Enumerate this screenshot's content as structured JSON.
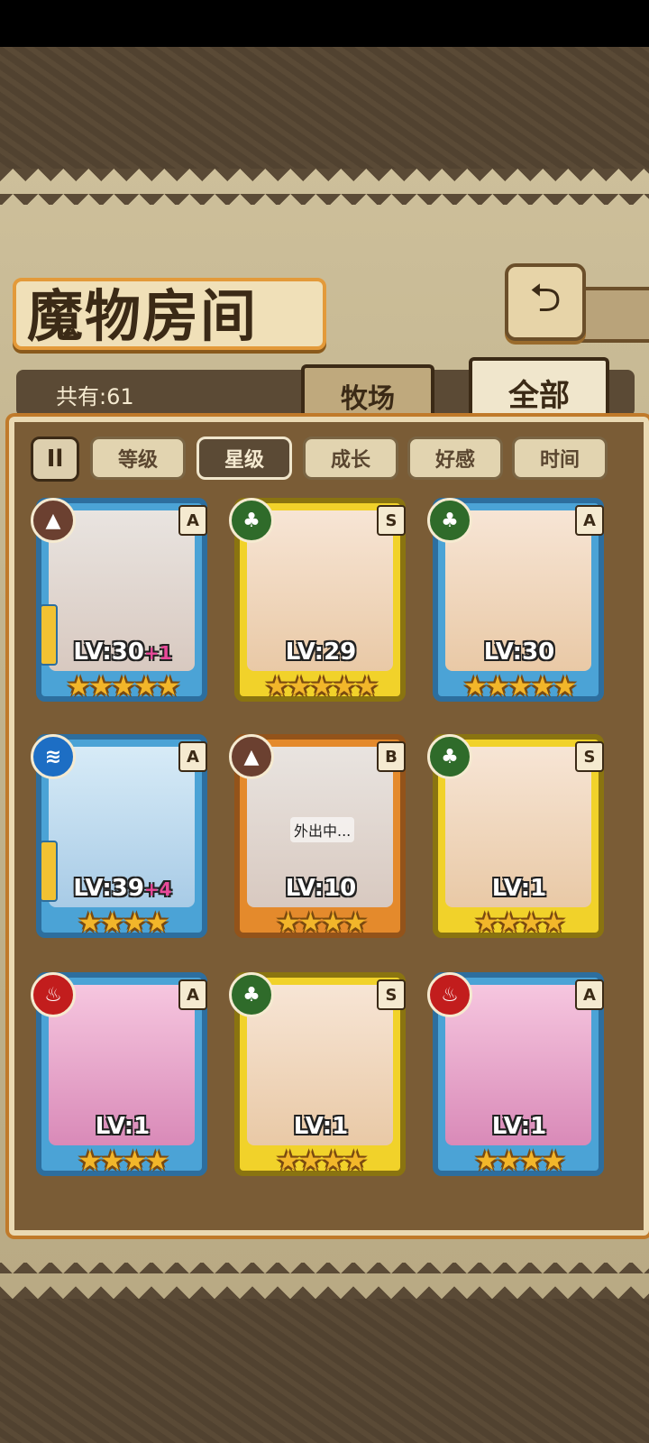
{
  "screen": {
    "title": "魔物房间",
    "back_icon": "return-icon",
    "count_label": "共有:61"
  },
  "tabs": [
    {
      "label": "牧场",
      "active": false
    },
    {
      "label": "全部",
      "active": true
    }
  ],
  "filters": {
    "toggle_label": "Il",
    "items": [
      {
        "label": "等级",
        "active": false
      },
      {
        "label": "星级",
        "active": true
      },
      {
        "label": "成长",
        "active": false
      },
      {
        "label": "好感",
        "active": false
      },
      {
        "label": "时间",
        "active": false
      }
    ]
  },
  "monsters": [
    {
      "lv_text": "LV:30",
      "plus": "+1",
      "rank": "A",
      "element": "earth",
      "stars": 5,
      "stars_text": "★★★★★",
      "weapon": true,
      "away_text": ""
    },
    {
      "lv_text": "LV:29",
      "plus": "",
      "rank": "S",
      "element": "leaf",
      "stars": 5,
      "stars_text": "★★★★★",
      "weapon": false,
      "away_text": ""
    },
    {
      "lv_text": "LV:30",
      "plus": "",
      "rank": "A",
      "element": "leaf",
      "stars": 5,
      "stars_text": "★★★★★",
      "weapon": false,
      "away_text": ""
    },
    {
      "lv_text": "LV:39",
      "plus": "+4",
      "rank": "A",
      "element": "water",
      "stars": 4,
      "stars_text": "★★★★",
      "weapon": true,
      "away_text": ""
    },
    {
      "lv_text": "LV:10",
      "plus": "",
      "rank": "B",
      "element": "earth",
      "stars": 4,
      "stars_text": "★★★★",
      "weapon": false,
      "away_text": "外出中..."
    },
    {
      "lv_text": "LV:1",
      "plus": "",
      "rank": "S",
      "element": "leaf",
      "stars": 4,
      "stars_text": "★★★★",
      "weapon": false,
      "away_text": ""
    },
    {
      "lv_text": "LV:1",
      "plus": "",
      "rank": "A",
      "element": "fire",
      "stars": 4,
      "stars_text": "★★★★",
      "weapon": false,
      "away_text": ""
    },
    {
      "lv_text": "LV:1",
      "plus": "",
      "rank": "S",
      "element": "leaf",
      "stars": 4,
      "stars_text": "★★★★",
      "weapon": false,
      "away_text": ""
    },
    {
      "lv_text": "LV:1",
      "plus": "",
      "rank": "A",
      "element": "fire",
      "stars": 4,
      "stars_text": "★★★★",
      "weapon": false,
      "away_text": ""
    }
  ],
  "colors": {
    "rank_A": "#4ba3d6",
    "rank_S": "#f1d22a",
    "rank_B": "#e48a2c",
    "star": "#f2b62a",
    "plus": "#e94a9a"
  }
}
